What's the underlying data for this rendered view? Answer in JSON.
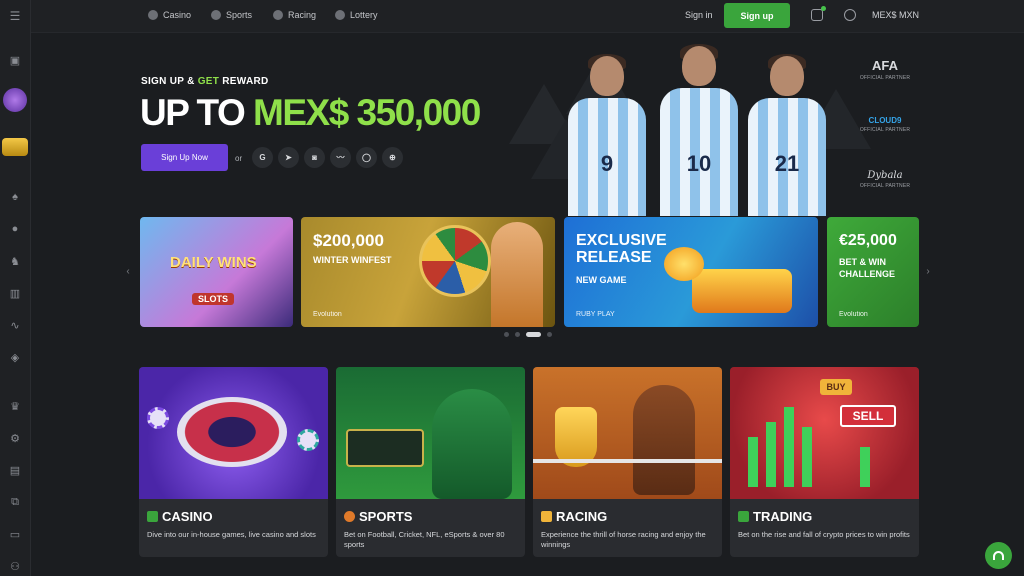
{
  "nav": {
    "items": [
      {
        "label": "Casino",
        "icon": "spade-icon"
      },
      {
        "label": "Sports",
        "icon": "ball-icon"
      },
      {
        "label": "Racing",
        "icon": "horse-icon"
      },
      {
        "label": "Lottery",
        "icon": "ticket-icon"
      }
    ],
    "signin": "Sign in",
    "signup": "Sign up",
    "currency": "MEX$ MXN"
  },
  "hero": {
    "kicker_a": "SIGN UP & ",
    "kicker_b": "GET",
    "kicker_c": " REWARD",
    "title_a": "UP TO ",
    "title_b": "MEX$ 350,000",
    "cta": "Sign Up Now",
    "or": "or",
    "social": [
      "G",
      "➤",
      "◙",
      "〰",
      "◯",
      "⊕"
    ],
    "jersey_numbers": [
      "9",
      "10",
      "21"
    ],
    "partners": [
      {
        "logo": "AFA",
        "caption": "OFFICIAL PARTNER"
      },
      {
        "logo": "CLOUD9",
        "caption": "OFFICIAL PARTNER"
      },
      {
        "logo": "Dybala",
        "caption": "OFFICIAL PARTNER"
      }
    ]
  },
  "carousel": {
    "slides": [
      {
        "heading": "DAILY WINS",
        "sub": "SLOTS",
        "brand": ""
      },
      {
        "heading": "$200,000",
        "sub": "WINTER WINFEST",
        "brand": "Evolution"
      },
      {
        "heading": "EXCLUSIVE RELEASE",
        "sub": "NEW GAME",
        "brand": "RUBY PLAY"
      },
      {
        "heading": "€25,000",
        "sub": "BET & WIN CHALLENGE",
        "brand": "Evolution"
      }
    ],
    "active_dot": 2
  },
  "categories": [
    {
      "title": "CASINO",
      "desc": "Dive into our in-house games, live casino and slots"
    },
    {
      "title": "SPORTS",
      "desc": "Bet on Football, Cricket, NFL, eSports & over 80 sports"
    },
    {
      "title": "RACING",
      "desc": "Experience the thrill of horse racing and enjoy the winnings"
    },
    {
      "title": "TRADING",
      "desc": "Bet on the rise and fall of crypto prices to win profits"
    }
  ],
  "colors": {
    "accent_green": "#3aa53c",
    "highlight_green": "#8fe04a",
    "cta_purple": "#6a3fd8"
  }
}
